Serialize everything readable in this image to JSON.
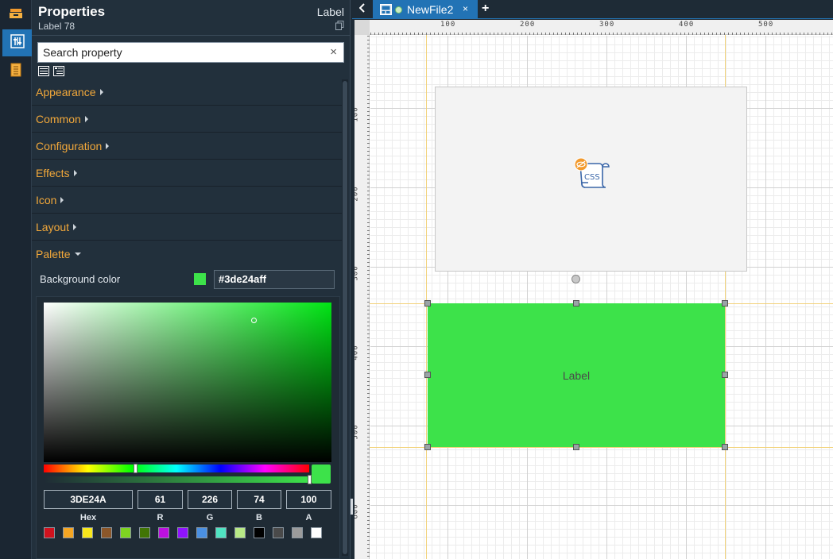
{
  "panel": {
    "title": "Properties",
    "subtitle": "Label 78",
    "type": "Label",
    "search_placeholder": "Search property",
    "search_clear": "×"
  },
  "sections": [
    {
      "label": "Appearance",
      "expanded": false
    },
    {
      "label": "Common",
      "expanded": false
    },
    {
      "label": "Configuration",
      "expanded": false
    },
    {
      "label": "Effects",
      "expanded": false
    },
    {
      "label": "Icon",
      "expanded": false
    },
    {
      "label": "Layout",
      "expanded": false
    },
    {
      "label": "Palette",
      "expanded": true
    }
  ],
  "palette": {
    "bg_label": "Background color",
    "bg_value": "#3de24aff",
    "color": "#3DE24A",
    "hue_color": "#00e414",
    "hue_fraction": 0.344,
    "saturation": 0.73,
    "value": 0.89,
    "alpha_fraction": 1.0,
    "fields": {
      "hex": "3DE24A",
      "r": "61",
      "g": "226",
      "b": "74",
      "a": "100"
    },
    "field_labels": {
      "hex": "Hex",
      "r": "R",
      "g": "G",
      "b": "B",
      "a": "A"
    },
    "swatches": [
      "#d0121e",
      "#f5a623",
      "#f8e71c",
      "#8b572a",
      "#7ed321",
      "#417505",
      "#bd10e0",
      "#9013fe",
      "#4a90e2",
      "#50e3c2",
      "#b8e986",
      "#000000",
      "#4a4a4a",
      "#9b9b9b",
      "#ffffff"
    ]
  },
  "tabs": {
    "active_label": "NewFile2",
    "close": "×",
    "add": "+"
  },
  "canvas": {
    "ruler_top": [
      "100",
      "200",
      "300",
      "400",
      "500"
    ],
    "ruler_left": [
      "100",
      "200",
      "300",
      "400",
      "500",
      "600"
    ],
    "label_text": "Label",
    "label_color": "#3de24a",
    "css_icon_text": "CSS"
  }
}
